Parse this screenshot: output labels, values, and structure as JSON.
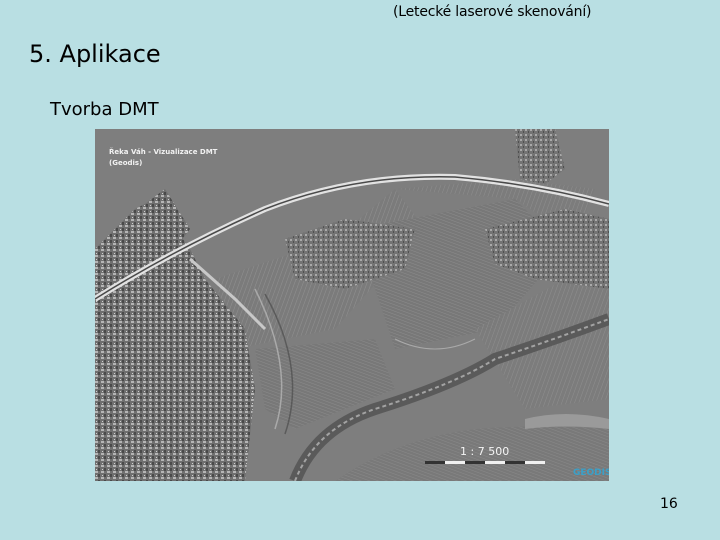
{
  "slide": {
    "header_note": "(Letecké laserové skenování)",
    "title": "5. Aplikace",
    "subtitle": "Tvorba DMT",
    "page_number": "16"
  },
  "map": {
    "title_line": "Řeka Váh - Vizualizace DMT",
    "credit_line": "(Geodis)",
    "scale": "1 : 7 500",
    "logo": "GEODIS"
  }
}
